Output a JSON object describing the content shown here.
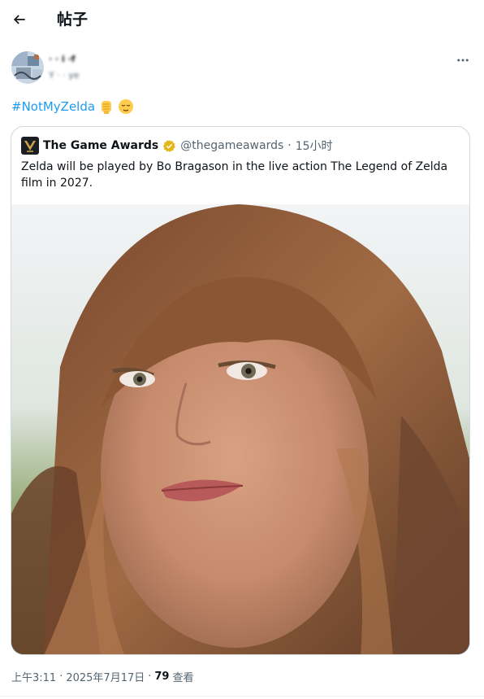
{
  "header": {
    "title": "帖子",
    "back_icon": "arrow-left-icon"
  },
  "author": {
    "name": "·  · i ·f",
    "handle": "Y  ·   ·  ye",
    "avatar_icon": "avatar-image"
  },
  "tweet": {
    "hashtag": "#NotMyZelda",
    "emojis": [
      "raised-fist-emoji",
      "relieved-face-emoji"
    ]
  },
  "quote": {
    "name": "The Game Awards",
    "handle": "@thegameawards",
    "separator": "·",
    "time": "15小时",
    "text": "Zelda will be played by Bo Bragason in the live action The Legend of Zelda film in 2027.",
    "verified_badge_color": "#e2b719",
    "image_description_icon": "portrait-photo"
  },
  "footer": {
    "time": "上午3:11",
    "separator1": "·",
    "date": "2025年7月17日",
    "separator2": "·",
    "views": "79",
    "views_label": "查看"
  },
  "colors": {
    "accent": "#1d9bf0",
    "text": "#0f1419",
    "muted": "#536471",
    "border": "#cfd9de"
  }
}
